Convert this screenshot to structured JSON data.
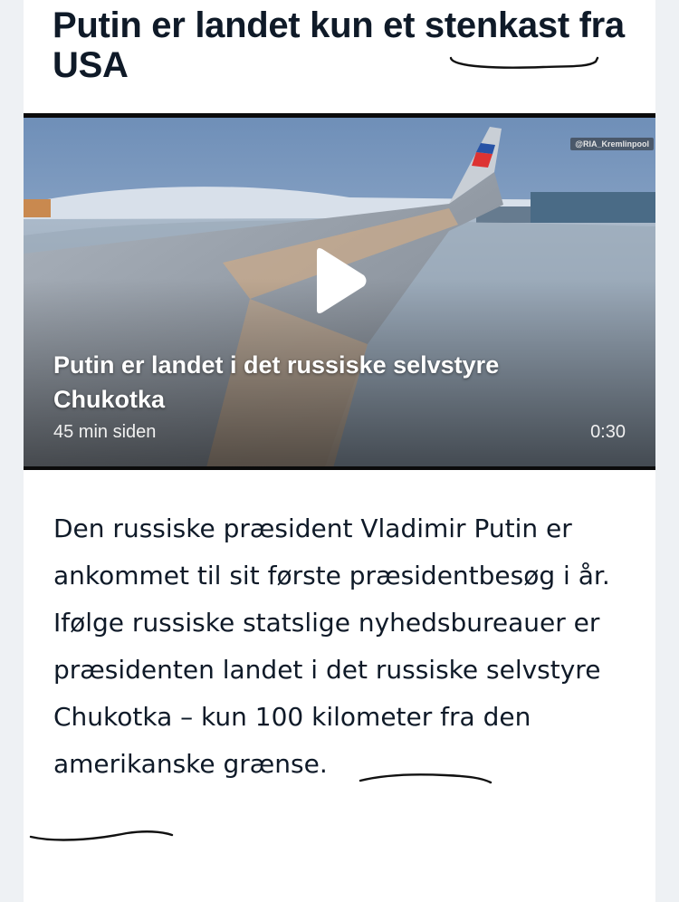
{
  "article": {
    "headline": "Putin er landet kun et stenkast fra USA",
    "body": "Den russiske præsident Vladimir Putin er ankommet til sit første præsidentbesøg i år. Ifølge russiske statslige nyhedsbureauer er præsidenten landet i det russiske selvstyre Chukotka – kun 100 kilometer fra den amerikanske grænse."
  },
  "video": {
    "title": "Putin er landet i det russiske selvstyre Chukotka",
    "time_ago": "45 min siden",
    "duration": "0:30",
    "watermark": "@RIA_Kremlinpool",
    "play_icon": "play-icon"
  },
  "colors": {
    "text": "#0f1a28",
    "background": "#eef1f4",
    "card": "#ffffff"
  }
}
